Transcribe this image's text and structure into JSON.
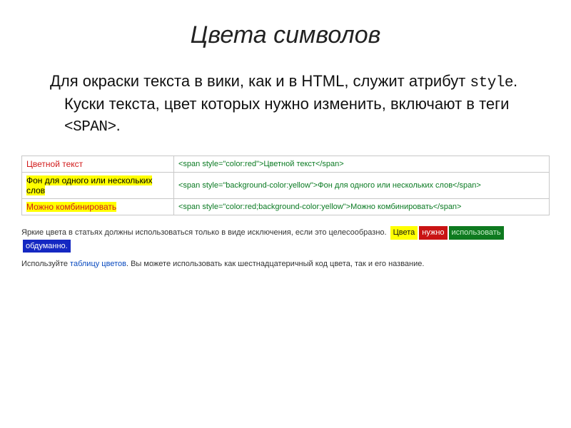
{
  "title": "Цвета символов",
  "body": {
    "p1_a": "Для окраски текста в вики, как и в HTML, служит атрибут ",
    "p1_style": "style",
    "p1_b": ". Куски текста, цвет которых нужно изменить, включают в теги ",
    "p1_span": "<SPAN>",
    "p1_c": "."
  },
  "examples": [
    {
      "display": "Цветной текст",
      "display_class": "red-text",
      "code": "<span style=\"color:red\">Цветной текст</span>"
    },
    {
      "display": "Фон для одного или нескольких слов",
      "display_class": "yellow-bg",
      "code": "<span style=\"background-color:yellow\">Фон для одного или нескольких слов</span>"
    },
    {
      "display": "Можно комбинировать",
      "display_class": "red-text yellow-bg",
      "code": "<span style=\"color:red;background-color:yellow\">Можно комбинировать</span>"
    }
  ],
  "footnote1": {
    "text": "Яркие цвета в статьях должны использоваться только в виде исключения, если это целесообразно. ",
    "chips": [
      {
        "label": "Цвета",
        "class": "chip-yellow"
      },
      {
        "label": "нужно",
        "class": "chip-red"
      },
      {
        "label": "использовать",
        "class": "chip-green"
      },
      {
        "label": "обдуманно.",
        "class": "chip-blue"
      }
    ]
  },
  "footnote2": {
    "a": "Используйте ",
    "link": "таблицу цветов",
    "b": ". Вы можете использовать как шестнадцатеричный код цвета, так и его название."
  }
}
